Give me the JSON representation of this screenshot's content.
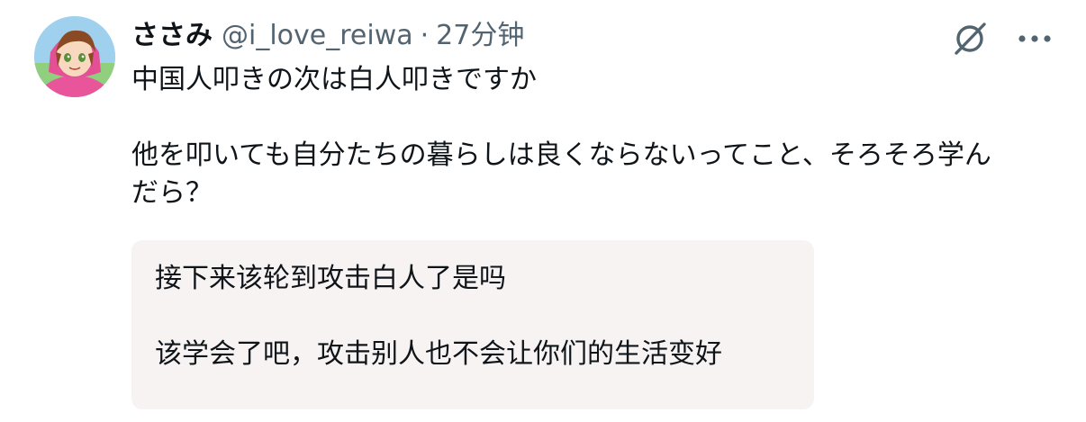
{
  "author": {
    "display_name": "ささみ",
    "handle": "@i_love_reiwa",
    "separator": "·",
    "time": "27分钟"
  },
  "post": {
    "line1": "中国人叩きの次は白人叩きですか",
    "line2": "他を叩いても自分たちの暮らしは良くならないってこと、そろそろ学ん",
    "line3": "だら？"
  },
  "translation": {
    "line1": "接下来该轮到攻击白人了是吗",
    "line2": "该学会了吧，攻击别人也不会让你们的生活变好"
  },
  "icons": {
    "translate": "no-translate-icon",
    "more": "more-options-icon"
  },
  "colors": {
    "text": "#0f1419",
    "secondary": "#536471",
    "translation_bg": "#f7f3f3"
  }
}
